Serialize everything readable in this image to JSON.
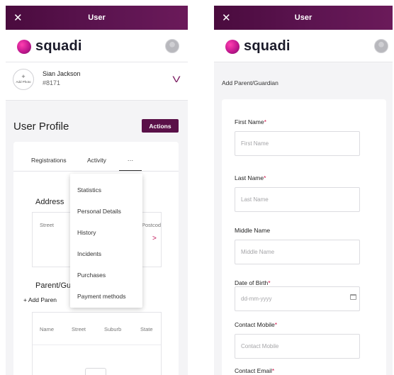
{
  "left": {
    "topbar": {
      "title": "User",
      "close": "✕"
    },
    "brand": {
      "logo_text": "squadi"
    },
    "member": {
      "add_photo_plus": "+",
      "add_photo": "Add Photo",
      "name": "Sian Jackson",
      "id": "#8171",
      "chevron": "V"
    },
    "profile_title": "User Profile",
    "actions_label": "Actions",
    "tabs": [
      "Registrations",
      "Activity",
      "···"
    ],
    "address": {
      "label": "Address",
      "columns": [
        "Street",
        "Postcod"
      ],
      "row_arrow": ">"
    },
    "menu": [
      "Statistics",
      "Personal Details",
      "History",
      "Incidents",
      "Purchases",
      "Payment methods"
    ],
    "parent": {
      "label": "Parent/Gu",
      "add_label": "+ Add Paren",
      "columns": [
        "Name",
        "Street",
        "Suburb",
        "State"
      ]
    }
  },
  "right": {
    "topbar": {
      "title": "User",
      "close": "✕"
    },
    "brand": {
      "logo_text": "squadi"
    },
    "heading": "Add Parent/Guardian",
    "fields": [
      {
        "label": "First Name",
        "required": "*",
        "placeholder": "First Name"
      },
      {
        "label": "Last Name",
        "required": "*",
        "placeholder": "Last Name"
      },
      {
        "label": "Middle Name",
        "required": "",
        "placeholder": "Middle Name"
      },
      {
        "label": "Date of Birth",
        "required": "*",
        "placeholder": "dd-mm-yyyy"
      },
      {
        "label": "Contact Mobile",
        "required": "*",
        "placeholder": "Contact Mobile"
      },
      {
        "label": "Contact Email",
        "required": "*",
        "placeholder": ""
      }
    ]
  }
}
